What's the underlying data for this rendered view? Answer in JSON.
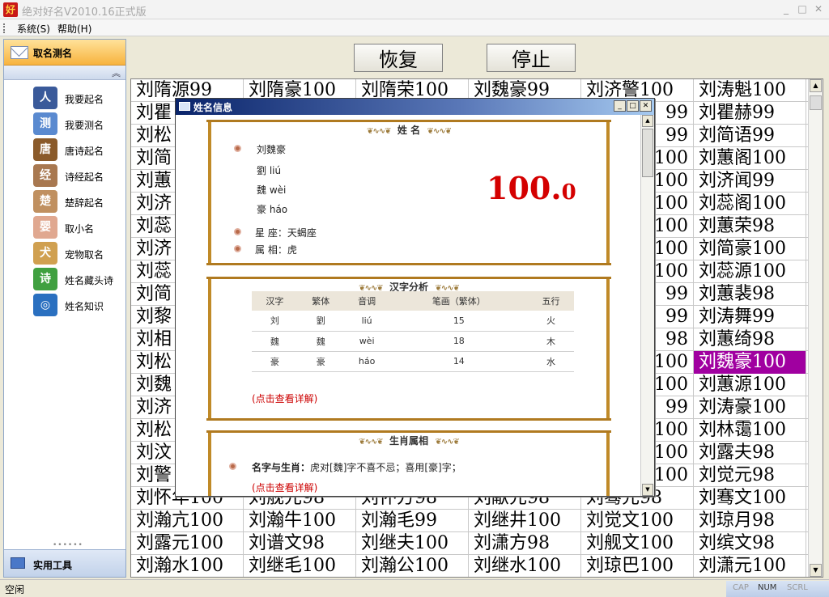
{
  "window": {
    "title": "绝对好名V2010.16正式版",
    "icon_glyph": "好",
    "min": "_",
    "max": "□",
    "close": "✕"
  },
  "menu": [
    "系统(S)",
    "帮助(H)"
  ],
  "sidebar": {
    "header": "取名测名",
    "collapse": "︽",
    "items": [
      {
        "label": "我要起名",
        "icon": "person-icon",
        "color": "#3a5a9a",
        "glyph": "人"
      },
      {
        "label": "我要测名",
        "icon": "magnifier-icon",
        "color": "#5a8ad0",
        "glyph": "测"
      },
      {
        "label": "唐诗起名",
        "icon": "tang-poetry-icon",
        "color": "#8a5a2a",
        "glyph": "唐"
      },
      {
        "label": "诗经起名",
        "icon": "shijing-icon",
        "color": "#a87850",
        "glyph": "经"
      },
      {
        "label": "楚辞起名",
        "icon": "chuci-icon",
        "color": "#c09060",
        "glyph": "楚"
      },
      {
        "label": "取小名",
        "icon": "baby-icon",
        "color": "#e0a890",
        "glyph": "婴"
      },
      {
        "label": "宠物取名",
        "icon": "dog-icon",
        "color": "#d0a050",
        "glyph": "犬"
      },
      {
        "label": "姓名藏头诗",
        "icon": "poem-icon",
        "color": "#40a040",
        "glyph": "诗"
      },
      {
        "label": "姓名知识",
        "icon": "globe-icon",
        "color": "#2a70c0",
        "glyph": "◎"
      }
    ],
    "bottom": "实用工具",
    "dots": "••••••"
  },
  "toolbar": {
    "restore": "恢复",
    "stop": "停止"
  },
  "grid": {
    "rows": [
      [
        "刘隋源99",
        "刘隋豪100",
        "刘隋荣100",
        "刘魏豪99",
        "刘济警100",
        "刘涛魁100"
      ],
      [
        "刘瞿",
        "",
        "",
        "",
        "99",
        "刘瞿赫99"
      ],
      [
        "刘松",
        "",
        "",
        "",
        "99",
        "刘简语99"
      ],
      [
        "刘简",
        "",
        "",
        "",
        "100",
        "刘蕙阁100"
      ],
      [
        "刘蕙",
        "",
        "",
        "",
        "100",
        "刘济闻99"
      ],
      [
        "刘济",
        "",
        "",
        "",
        "100",
        "刘蕊阁100"
      ],
      [
        "刘蕊",
        "",
        "",
        "",
        "100",
        "刘蕙荣98"
      ],
      [
        "刘济",
        "",
        "",
        "",
        "100",
        "刘简豪100"
      ],
      [
        "刘蕊",
        "",
        "",
        "",
        "100",
        "刘蕊源100"
      ],
      [
        "刘简",
        "",
        "",
        "",
        "99",
        "刘蕙裴98"
      ],
      [
        "刘黎",
        "",
        "",
        "",
        "99",
        "刘涛舞99"
      ],
      [
        "刘相",
        "",
        "",
        "",
        "98",
        "刘蕙绮98"
      ],
      [
        "刘松",
        "",
        "",
        "",
        "100",
        "刘魏豪100"
      ],
      [
        "刘魏",
        "",
        "",
        "",
        "100",
        "刘蕙源100"
      ],
      [
        "刘济",
        "",
        "",
        "",
        "99",
        "刘涛豪100"
      ],
      [
        "刘松",
        "",
        "",
        "",
        "100",
        "刘林霭100"
      ],
      [
        "刘汶",
        "",
        "",
        "",
        "100",
        "刘露夫98"
      ],
      [
        "刘警",
        "",
        "",
        "",
        "100",
        "刘觉元98"
      ],
      [
        "刘怀年100",
        "刘舰元98",
        "刘怀方98",
        "刘献元98",
        "刘骞元98",
        "刘骞文100"
      ],
      [
        "刘瀚亢100",
        "刘瀚牛100",
        "刘瀚毛99",
        "刘继井100",
        "刘觉文100",
        "刘琼月98"
      ],
      [
        "刘露元100",
        "刘谱文98",
        "刘继夫100",
        "刘潇方98",
        "刘舰文100",
        "刘缤文98"
      ],
      [
        "刘瀚水100",
        "刘继毛100",
        "刘瀚公100",
        "刘继水100",
        "刘琼巴100",
        "刘潇元100"
      ]
    ]
  },
  "dialog": {
    "title": "姓名信息",
    "name_section": {
      "title": "姓 名",
      "name": "刘魏豪",
      "chars": [
        {
          "trad": "劉",
          "pinyin": "liú"
        },
        {
          "trad": "魏",
          "pinyin": "wèi"
        },
        {
          "trad": "豪",
          "pinyin": "háo"
        }
      ],
      "constellation": "星 座：天蝎座",
      "zodiac": "属 相：虎",
      "score_big": "100.",
      "score_small": "0"
    },
    "hanzi_section": {
      "title": "汉字分析",
      "headers": [
        "汉字",
        "繁体",
        "音调",
        "笔画（繁体）",
        "五行"
      ],
      "rows": [
        [
          "刘",
          "劉",
          "liú",
          "15",
          "火"
        ],
        [
          "魏",
          "魏",
          "wèi",
          "18",
          "木"
        ],
        [
          "豪",
          "豪",
          "háo",
          "14",
          "水"
        ]
      ],
      "link": "(点击查看详解)"
    },
    "zodiac_section": {
      "title": "生肖属相",
      "label": "名字与生肖：",
      "text": "虎对[魏]字不喜不忌；喜用[豪]字；",
      "link": "(点击查看详解)"
    },
    "ornament": "❦∿∿❦"
  },
  "status": {
    "text": "空闲",
    "cap": "CAP",
    "num": "NUM",
    "scrl": "SCRL"
  }
}
